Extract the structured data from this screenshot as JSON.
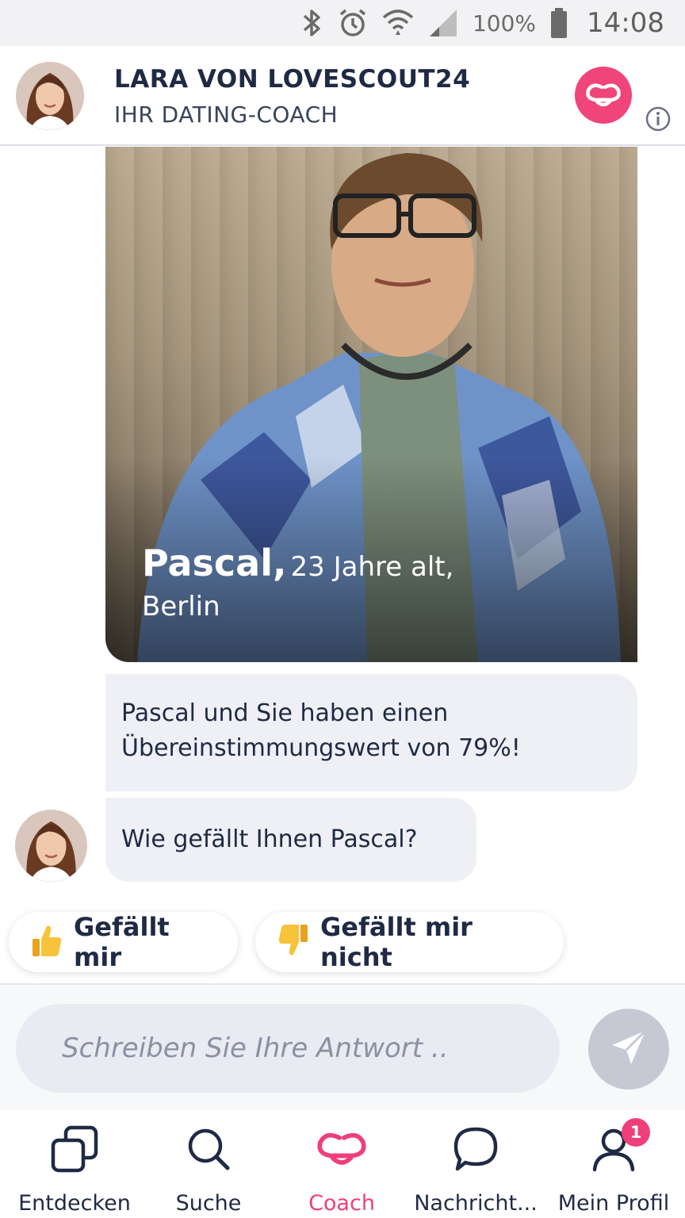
{
  "status_bar": {
    "icons": [
      "bluetooth-icon",
      "alarm-icon",
      "wifi-icon",
      "signal-icon",
      "battery-icon"
    ],
    "battery": "100%",
    "time": "14:08"
  },
  "header": {
    "title": "LARA VON LOVESCOUT24",
    "subtitle": "IHR DATING-COACH",
    "brand_color": "#f0457a",
    "info_icon": "info-icon"
  },
  "profile_card": {
    "name": "Pascal,",
    "age": "23 Jahre alt,",
    "city": "Berlin"
  },
  "messages": [
    {
      "text": "Pascal und Sie haben einen Übereinstimmungswert von 79%!"
    },
    {
      "text": "Wie gefällt Ihnen Pascal?"
    }
  ],
  "quick_replies": [
    {
      "label": "Gefällt mir",
      "icon": "thumbs-up-icon"
    },
    {
      "label": "Gefällt mir nicht",
      "icon": "thumbs-down-icon"
    }
  ],
  "composer": {
    "placeholder": "Schreiben Sie Ihre Antwort ..",
    "send_icon": "send-icon"
  },
  "bottom_nav": {
    "accent_color": "#ef3f7a",
    "items": [
      {
        "label": "Entdecken",
        "icon": "cards-icon"
      },
      {
        "label": "Suche",
        "icon": "search-icon"
      },
      {
        "label": "Coach",
        "icon": "coach-logo-icon",
        "active": true
      },
      {
        "label": "Nachricht...",
        "icon": "chat-bubble-icon"
      },
      {
        "label": "Mein Profil",
        "icon": "profile-icon",
        "badge": "1"
      }
    ]
  }
}
